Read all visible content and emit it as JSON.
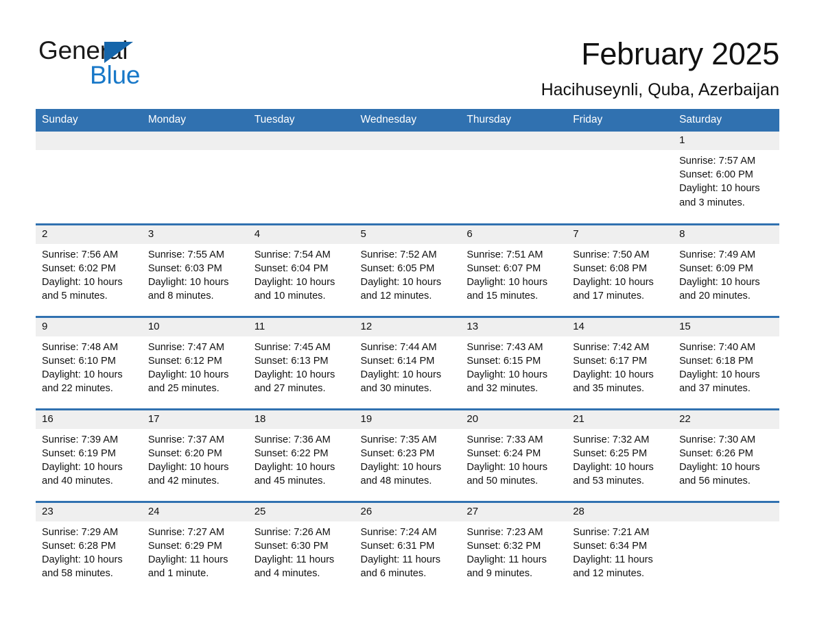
{
  "brand": {
    "name_part1": "General",
    "name_part2": "Blue",
    "triangle_color": "#1565aa",
    "blue_color": "#1878c8"
  },
  "header": {
    "title": "February 2025",
    "subtitle": "Hacihuseynli, Quba, Azerbaijan"
  },
  "colors": {
    "header_blue": "#3071b0",
    "day_strip_gray": "#efefef",
    "text": "#111111"
  },
  "weekday_headers": [
    "Sunday",
    "Monday",
    "Tuesday",
    "Wednesday",
    "Thursday",
    "Friday",
    "Saturday"
  ],
  "weeks": [
    [
      {
        "day": "",
        "sunrise": "",
        "sunset": "",
        "daylight": ""
      },
      {
        "day": "",
        "sunrise": "",
        "sunset": "",
        "daylight": ""
      },
      {
        "day": "",
        "sunrise": "",
        "sunset": "",
        "daylight": ""
      },
      {
        "day": "",
        "sunrise": "",
        "sunset": "",
        "daylight": ""
      },
      {
        "day": "",
        "sunrise": "",
        "sunset": "",
        "daylight": ""
      },
      {
        "day": "",
        "sunrise": "",
        "sunset": "",
        "daylight": ""
      },
      {
        "day": "1",
        "sunrise": "Sunrise: 7:57 AM",
        "sunset": "Sunset: 6:00 PM",
        "daylight": "Daylight: 10 hours and 3 minutes."
      }
    ],
    [
      {
        "day": "2",
        "sunrise": "Sunrise: 7:56 AM",
        "sunset": "Sunset: 6:02 PM",
        "daylight": "Daylight: 10 hours and 5 minutes."
      },
      {
        "day": "3",
        "sunrise": "Sunrise: 7:55 AM",
        "sunset": "Sunset: 6:03 PM",
        "daylight": "Daylight: 10 hours and 8 minutes."
      },
      {
        "day": "4",
        "sunrise": "Sunrise: 7:54 AM",
        "sunset": "Sunset: 6:04 PM",
        "daylight": "Daylight: 10 hours and 10 minutes."
      },
      {
        "day": "5",
        "sunrise": "Sunrise: 7:52 AM",
        "sunset": "Sunset: 6:05 PM",
        "daylight": "Daylight: 10 hours and 12 minutes."
      },
      {
        "day": "6",
        "sunrise": "Sunrise: 7:51 AM",
        "sunset": "Sunset: 6:07 PM",
        "daylight": "Daylight: 10 hours and 15 minutes."
      },
      {
        "day": "7",
        "sunrise": "Sunrise: 7:50 AM",
        "sunset": "Sunset: 6:08 PM",
        "daylight": "Daylight: 10 hours and 17 minutes."
      },
      {
        "day": "8",
        "sunrise": "Sunrise: 7:49 AM",
        "sunset": "Sunset: 6:09 PM",
        "daylight": "Daylight: 10 hours and 20 minutes."
      }
    ],
    [
      {
        "day": "9",
        "sunrise": "Sunrise: 7:48 AM",
        "sunset": "Sunset: 6:10 PM",
        "daylight": "Daylight: 10 hours and 22 minutes."
      },
      {
        "day": "10",
        "sunrise": "Sunrise: 7:47 AM",
        "sunset": "Sunset: 6:12 PM",
        "daylight": "Daylight: 10 hours and 25 minutes."
      },
      {
        "day": "11",
        "sunrise": "Sunrise: 7:45 AM",
        "sunset": "Sunset: 6:13 PM",
        "daylight": "Daylight: 10 hours and 27 minutes."
      },
      {
        "day": "12",
        "sunrise": "Sunrise: 7:44 AM",
        "sunset": "Sunset: 6:14 PM",
        "daylight": "Daylight: 10 hours and 30 minutes."
      },
      {
        "day": "13",
        "sunrise": "Sunrise: 7:43 AM",
        "sunset": "Sunset: 6:15 PM",
        "daylight": "Daylight: 10 hours and 32 minutes."
      },
      {
        "day": "14",
        "sunrise": "Sunrise: 7:42 AM",
        "sunset": "Sunset: 6:17 PM",
        "daylight": "Daylight: 10 hours and 35 minutes."
      },
      {
        "day": "15",
        "sunrise": "Sunrise: 7:40 AM",
        "sunset": "Sunset: 6:18 PM",
        "daylight": "Daylight: 10 hours and 37 minutes."
      }
    ],
    [
      {
        "day": "16",
        "sunrise": "Sunrise: 7:39 AM",
        "sunset": "Sunset: 6:19 PM",
        "daylight": "Daylight: 10 hours and 40 minutes."
      },
      {
        "day": "17",
        "sunrise": "Sunrise: 7:37 AM",
        "sunset": "Sunset: 6:20 PM",
        "daylight": "Daylight: 10 hours and 42 minutes."
      },
      {
        "day": "18",
        "sunrise": "Sunrise: 7:36 AM",
        "sunset": "Sunset: 6:22 PM",
        "daylight": "Daylight: 10 hours and 45 minutes."
      },
      {
        "day": "19",
        "sunrise": "Sunrise: 7:35 AM",
        "sunset": "Sunset: 6:23 PM",
        "daylight": "Daylight: 10 hours and 48 minutes."
      },
      {
        "day": "20",
        "sunrise": "Sunrise: 7:33 AM",
        "sunset": "Sunset: 6:24 PM",
        "daylight": "Daylight: 10 hours and 50 minutes."
      },
      {
        "day": "21",
        "sunrise": "Sunrise: 7:32 AM",
        "sunset": "Sunset: 6:25 PM",
        "daylight": "Daylight: 10 hours and 53 minutes."
      },
      {
        "day": "22",
        "sunrise": "Sunrise: 7:30 AM",
        "sunset": "Sunset: 6:26 PM",
        "daylight": "Daylight: 10 hours and 56 minutes."
      }
    ],
    [
      {
        "day": "23",
        "sunrise": "Sunrise: 7:29 AM",
        "sunset": "Sunset: 6:28 PM",
        "daylight": "Daylight: 10 hours and 58 minutes."
      },
      {
        "day": "24",
        "sunrise": "Sunrise: 7:27 AM",
        "sunset": "Sunset: 6:29 PM",
        "daylight": "Daylight: 11 hours and 1 minute."
      },
      {
        "day": "25",
        "sunrise": "Sunrise: 7:26 AM",
        "sunset": "Sunset: 6:30 PM",
        "daylight": "Daylight: 11 hours and 4 minutes."
      },
      {
        "day": "26",
        "sunrise": "Sunrise: 7:24 AM",
        "sunset": "Sunset: 6:31 PM",
        "daylight": "Daylight: 11 hours and 6 minutes."
      },
      {
        "day": "27",
        "sunrise": "Sunrise: 7:23 AM",
        "sunset": "Sunset: 6:32 PM",
        "daylight": "Daylight: 11 hours and 9 minutes."
      },
      {
        "day": "28",
        "sunrise": "Sunrise: 7:21 AM",
        "sunset": "Sunset: 6:34 PM",
        "daylight": "Daylight: 11 hours and 12 minutes."
      },
      {
        "day": "",
        "sunrise": "",
        "sunset": "",
        "daylight": ""
      }
    ]
  ]
}
